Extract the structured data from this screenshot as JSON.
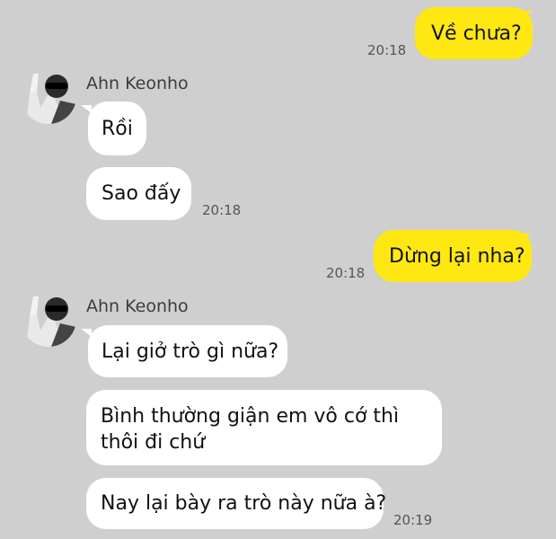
{
  "chat": {
    "messages": [
      {
        "id": "m1",
        "from": "me",
        "text": "Về chưa?",
        "time": "20:18"
      },
      {
        "id": "m2",
        "from": "them",
        "sender": "Ahn Keonho",
        "text": "Rồi",
        "time": ""
      },
      {
        "id": "m3",
        "from": "them",
        "text": "Sao đấy",
        "time": "20:18"
      },
      {
        "id": "m4",
        "from": "me",
        "text": "Dừng lại nha?",
        "time": "20:18"
      },
      {
        "id": "m5",
        "from": "them",
        "sender": "Ahn Keonho",
        "text": "Lại giở trò gì nữa?",
        "time": ""
      },
      {
        "id": "m6",
        "from": "them",
        "text": "Bình thường giận em vô cớ thì thôi đi chứ",
        "time": ""
      },
      {
        "id": "m7",
        "from": "them",
        "text": "Nay lại bày ra trò này nữa à?",
        "time": "20:19"
      }
    ]
  },
  "colors": {
    "background": "#cfcfcf",
    "my_bubble": "#ffe812",
    "their_bubble": "#ffffff"
  },
  "icons": {
    "avatar": "contact-avatar-photo"
  }
}
